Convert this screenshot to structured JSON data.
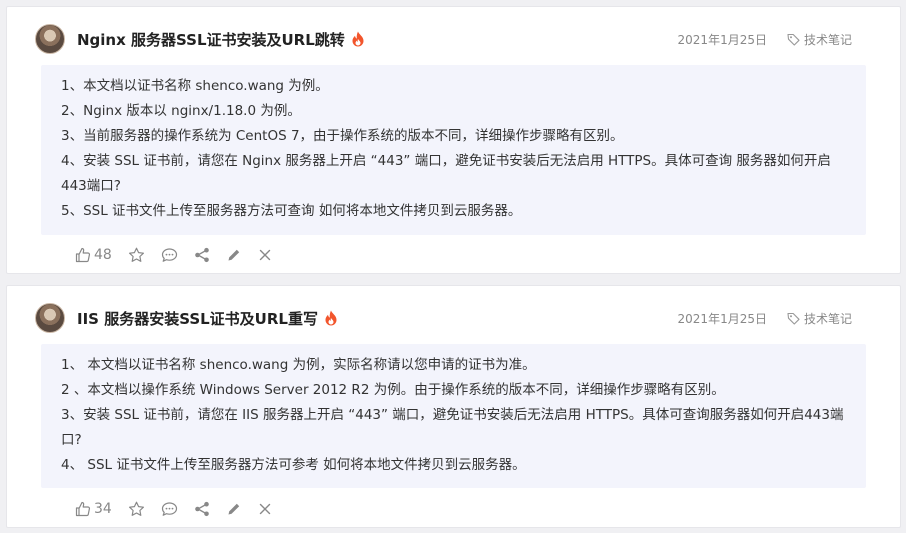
{
  "posts": [
    {
      "title": "Nginx 服务器SSL证书安装及URL跳转",
      "date": "2021年1月25日",
      "tag": "技术笔记",
      "lines": [
        "1、本文档以证书名称 shenco.wang 为例。",
        "2、Nginx 版本以 nginx/1.18.0 为例。",
        "3、当前服务器的操作系统为 CentOS 7，由于操作系统的版本不同，详细操作步骤略有区别。",
        "4、安装 SSL 证书前，请您在 Nginx 服务器上开启 “443” 端口，避免证书安装后无法启用 HTTPS。具体可查询 服务器如何开启443端口?",
        "5、SSL 证书文件上传至服务器方法可查询 如何将本地文件拷贝到云服务器。"
      ],
      "likes": "48"
    },
    {
      "title": "IIS 服务器安装SSL证书及URL重写",
      "date": "2021年1月25日",
      "tag": "技术笔记",
      "lines": [
        "1、 本文档以证书名称 shenco.wang 为例，实际名称请以您申请的证书为准。",
        "2 、本文档以操作系统 Windows Server 2012 R2 为例。由于操作系统的版本不同，详细操作步骤略有区别。",
        "3、安装 SSL 证书前，请您在 IIS 服务器上开启 “443” 端口，避免证书安装后无法启用 HTTPS。具体可查询服务器如何开启443端口?",
        "4、 SSL 证书文件上传至服务器方法可参考 如何将本地文件拷贝到云服务器。"
      ],
      "likes": "34"
    }
  ],
  "icons": {
    "fire": "fire-icon",
    "tag": "tag-icon",
    "like": "thumbs-up-icon",
    "star": "star-icon",
    "comment": "comment-icon",
    "share": "share-icon",
    "edit": "pencil-icon",
    "delete": "close-icon"
  },
  "colors": {
    "fire": "#f2552c",
    "content_bg": "#f3f4fc",
    "meta": "#888888"
  }
}
